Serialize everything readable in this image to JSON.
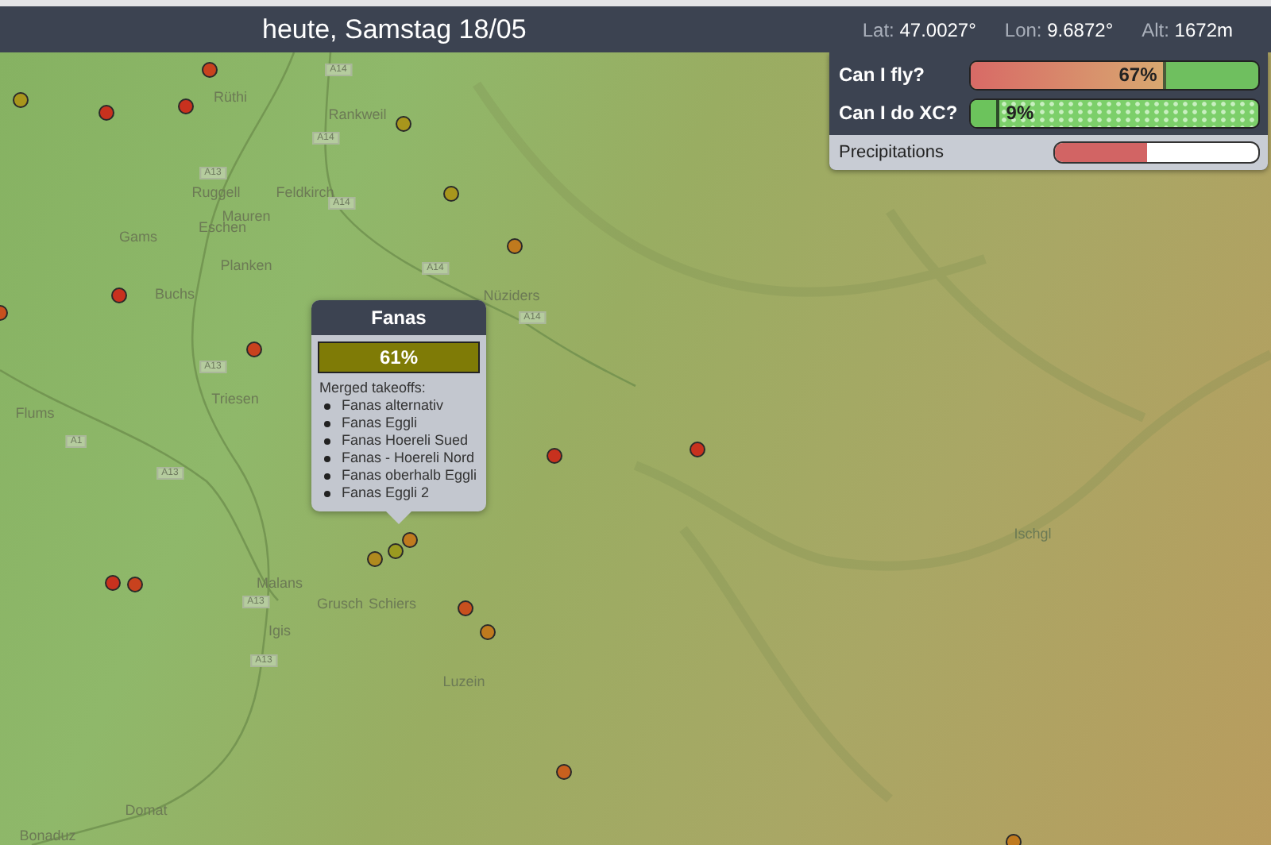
{
  "header": {
    "title": "heute, Samstag 18/05",
    "coords": [
      {
        "label": "Lat:",
        "value": "47.0027°"
      },
      {
        "label": "Lon:",
        "value": "9.6872°"
      },
      {
        "label": "Alt:",
        "value": "1672m"
      }
    ]
  },
  "forecast": {
    "rows": [
      {
        "label": "Can I fly?",
        "kind": "fly",
        "level": 0.67,
        "reading": "67%"
      },
      {
        "label": "Can I do XC?",
        "kind": "xc",
        "level": 0.09,
        "reading": "9%"
      }
    ],
    "precipitation": {
      "label": "Precipitations",
      "level": 0.45
    }
  },
  "map": {
    "places": [
      "Rüthi",
      "Rankweil",
      "Ruggell",
      "Feldkirch",
      "Mauren",
      "Eschen",
      "Gams",
      "Planken",
      "Nüziders",
      "Buchs",
      "Triesen",
      "Flums",
      "Malans",
      "Grusch",
      "Schiers",
      "Igis",
      "Luzein",
      "Domat",
      "Bonaduz",
      "Ischgl"
    ],
    "roads": [
      "A14",
      "A14",
      "A13",
      "A14",
      "A14",
      "A14",
      "A13",
      "A1",
      "A13",
      "A13",
      "A13"
    ],
    "markers": [
      {
        "color": "#a8961c"
      },
      {
        "color": "#c8311e"
      },
      {
        "color": "#c8311e"
      },
      {
        "color": "#c8421e"
      },
      {
        "color": "#a8961c"
      },
      {
        "color": "#a8961c"
      },
      {
        "color": "#c07a1e"
      },
      {
        "color": "#c8501e"
      },
      {
        "color": "#c8311e"
      },
      {
        "color": "#c8421e"
      },
      {
        "color": "#c8311e"
      },
      {
        "color": "#c07a1e"
      },
      {
        "color": "#9a9a20"
      },
      {
        "color": "#b08a1e"
      },
      {
        "color": "#c8311e"
      },
      {
        "color": "#c8421e"
      },
      {
        "color": "#c8501e"
      },
      {
        "color": "#c07a1e"
      },
      {
        "color": "#c8601e"
      },
      {
        "color": "#c8311e"
      },
      {
        "color": "#c07a1e"
      }
    ],
    "popup": {
      "title": "Fanas",
      "score": "61%",
      "caption": "Merged takeoffs:",
      "takeoffs": [
        "Fanas alternativ",
        "Fanas Eggli",
        "Fanas Hoereli Sued",
        "Fanas - Hoereli Nord",
        "Fanas oberhalb Eggli",
        "Fanas Eggli 2"
      ]
    }
  }
}
